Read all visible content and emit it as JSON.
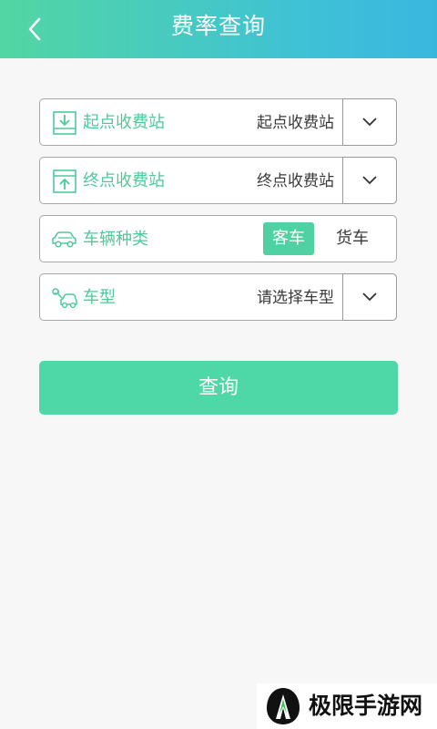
{
  "header": {
    "title": "费率查询",
    "back_icon": "chevron-left-icon",
    "gradient_colors": [
      "#52d6a3",
      "#3ab7df"
    ]
  },
  "form": {
    "start_station": {
      "icon": "download-box-icon",
      "label": "起点收费站",
      "value": "起点收费站"
    },
    "end_station": {
      "icon": "upload-box-icon",
      "label": "终点收费站",
      "value": "终点收费站"
    },
    "vehicle_category": {
      "icon": "car-icon",
      "label": "车辆种类",
      "options": [
        "客车",
        "货车"
      ],
      "selected": "客车"
    },
    "vehicle_type": {
      "icon": "car-wrench-icon",
      "label": "车型",
      "value": "请选择车型"
    }
  },
  "query_button": {
    "label": "查询"
  },
  "watermark": {
    "text": "极限手游网"
  },
  "colors": {
    "accent": "#4fd1a3",
    "label_green": "#4fc99a",
    "background": "#f7f7f7"
  }
}
